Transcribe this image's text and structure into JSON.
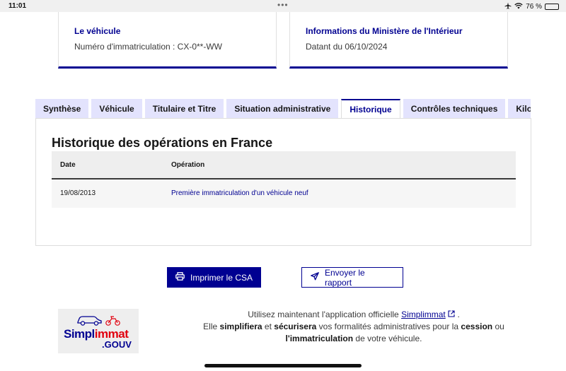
{
  "status_bar": {
    "time": "11:01",
    "dots": "•••",
    "battery": "76 %",
    "battery_level": 0.76,
    "icons": [
      "airplane-icon",
      "wifi-icon",
      "battery-icon"
    ]
  },
  "cards": {
    "vehicle": {
      "title": "Le véhicule",
      "text": "Numéro d'immatriculation : CX-0**-WW"
    },
    "ministry": {
      "title": "Informations du Ministère de l'Intérieur",
      "text": "Datant du 06/10/2024"
    }
  },
  "tabs": [
    {
      "label": "Synthèse",
      "active": false
    },
    {
      "label": "Véhicule",
      "active": false
    },
    {
      "label": "Titulaire et Titre",
      "active": false
    },
    {
      "label": "Situation administrative",
      "active": false
    },
    {
      "label": "Historique",
      "active": true
    },
    {
      "label": "Contrôles techniques",
      "active": false
    },
    {
      "label": "Kilo",
      "active": false
    }
  ],
  "history": {
    "title": "Historique des opérations en France",
    "columns": [
      "Date",
      "Opération"
    ],
    "rows": [
      {
        "date": "19/08/2013",
        "operation": "Première immatriculation d'un véhicule neuf"
      }
    ]
  },
  "actions": {
    "print_label": "Imprimer le CSA",
    "send_label": "Envoyer le rapport"
  },
  "logo": {
    "word_part1": "Simpl",
    "word_part2": "immat",
    "suffix": ".GOUV"
  },
  "promo": {
    "line1_prefix": "Utilisez maintenant l'application officielle",
    "app_link": "Simplimmat",
    "line1_suffix": ".",
    "line2_a": "Elle",
    "line2_b": "simplifiera",
    "line2_c": "et",
    "line2_d": "sécurisera",
    "line2_e": "vos formalités administratives pour la",
    "line2_f": "cession",
    "line2_g": "ou",
    "line3_a": "l'immatriculation",
    "line3_b": "de votre véhicule."
  },
  "colors": {
    "accent": "#000091",
    "tab_bg": "#e3e3fd",
    "logo_red": "#e1000f"
  }
}
